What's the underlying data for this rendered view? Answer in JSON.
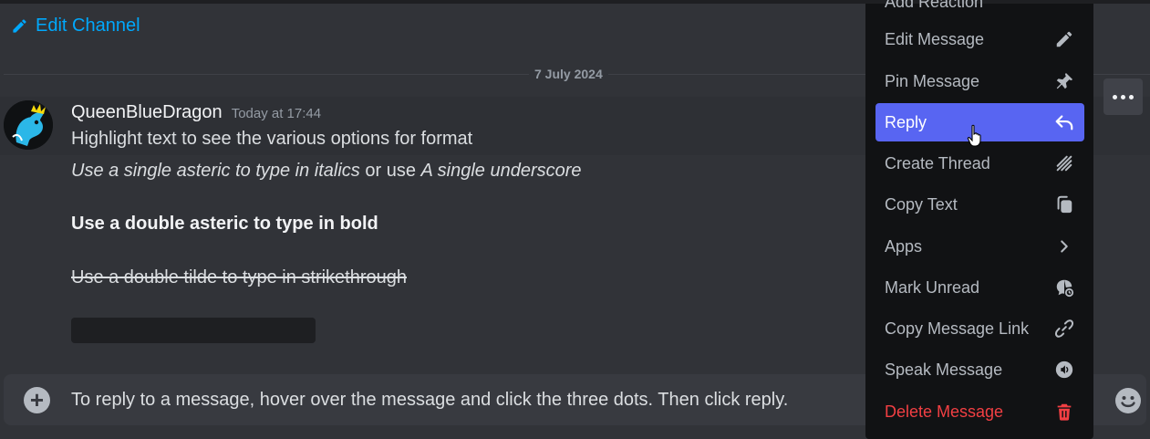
{
  "channel": {
    "edit_label": "Edit Channel"
  },
  "divider": {
    "date": "7 July 2024"
  },
  "message": {
    "username": "QueenBlueDragon",
    "timestamp": "Today at 17:44",
    "line1": "Highlight text to see the various options for format",
    "line2_italic_a": "Use a single asteric to type in italics",
    "line2_plain": " or use ",
    "line2_italic_b": "A single underscore",
    "line3_bold": "Use a double asteric to type in bold",
    "line4_strike": "Use a double tilde to type in strikethrough"
  },
  "composer": {
    "text": "To reply to a message, hover over the message and click the three dots. Then click reply."
  },
  "context_menu": {
    "partial_top_item": "Add Reaction",
    "items": [
      {
        "label": "Edit Message",
        "icon": "pencil-icon"
      },
      {
        "label": "Pin Message",
        "icon": "pin-icon"
      },
      {
        "label": "Reply",
        "icon": "reply-arrow-icon",
        "active": true
      },
      {
        "label": "Create Thread",
        "icon": "thread-icon"
      },
      {
        "label": "Copy Text",
        "icon": "copy-icon"
      },
      {
        "label": "Apps",
        "icon": "chevron-right-icon"
      },
      {
        "label": "Mark Unread",
        "icon": "mark-unread-icon"
      },
      {
        "label": "Copy Message Link",
        "icon": "link-icon"
      },
      {
        "label": "Speak Message",
        "icon": "speak-icon"
      },
      {
        "label": "Delete Message",
        "icon": "trash-icon",
        "danger": true
      }
    ]
  },
  "colors": {
    "accent": "#5865f2",
    "link": "#00a8fc",
    "danger": "#f23f43",
    "background": "#313338",
    "menu_background": "#111214"
  }
}
